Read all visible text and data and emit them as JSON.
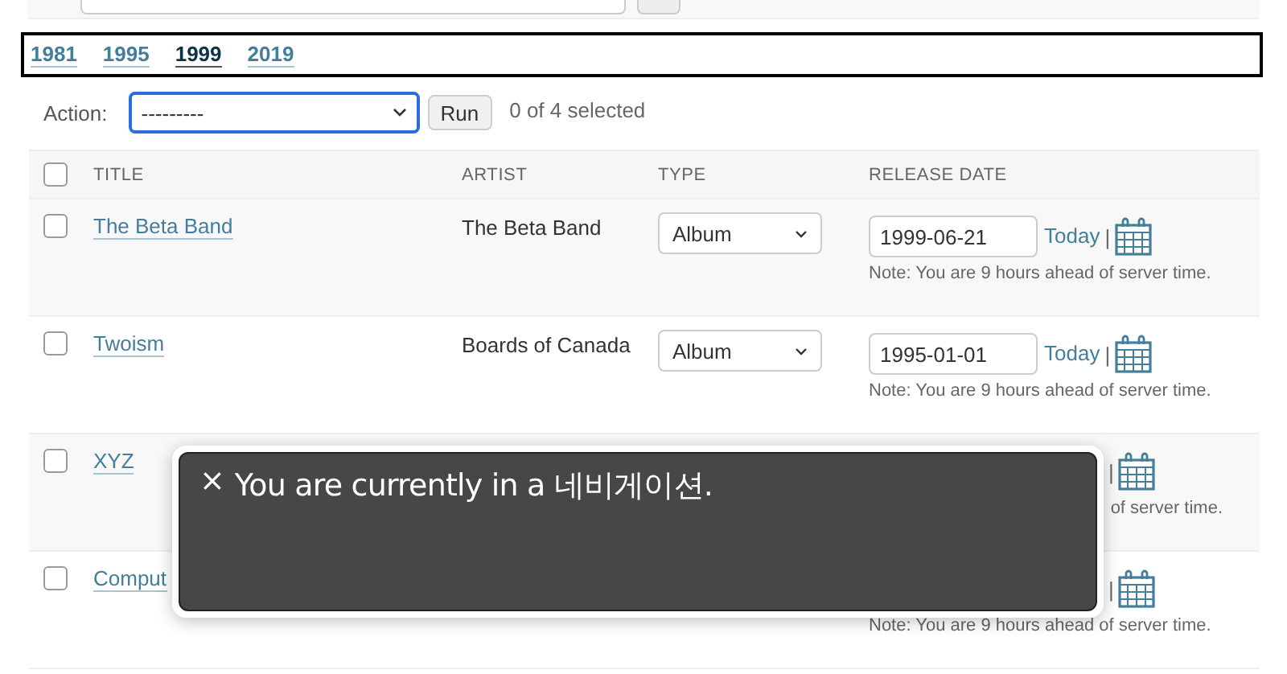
{
  "years": [
    {
      "label": "1981",
      "selected": false
    },
    {
      "label": "1995",
      "selected": false
    },
    {
      "label": "1999",
      "selected": true
    },
    {
      "label": "2019",
      "selected": false
    }
  ],
  "actions": {
    "label": "Action:",
    "select_value": "---------",
    "run_button": "Run",
    "counter": "0 of 4 selected"
  },
  "table": {
    "select_all_checked": false,
    "columns": [
      "TITLE",
      "ARTIST",
      "TYPE",
      "RELEASE DATE"
    ],
    "rows": [
      {
        "checked": false,
        "title": "The Beta Band",
        "artist": "The Beta Band",
        "type": "Album",
        "date": "1999-06-21",
        "today": "Today",
        "separator": "|",
        "note": "Note: You are 9 hours ahead of server time."
      },
      {
        "checked": false,
        "title": "Twoism",
        "artist": "Boards of Canada",
        "type": "Album",
        "date": "1995-01-01",
        "today": "Today",
        "separator": "|",
        "note": "Note: You are 9 hours ahead of server time."
      },
      {
        "checked": false,
        "title": "XYZ",
        "separator": "|",
        "note": "of server time."
      },
      {
        "checked": false,
        "title": "Comput",
        "separator": "|",
        "note": "Note: You are 9 hours ahead of server time."
      }
    ]
  },
  "caption_panel": {
    "close": "×",
    "text": "You are currently in a 네비게이션."
  }
}
